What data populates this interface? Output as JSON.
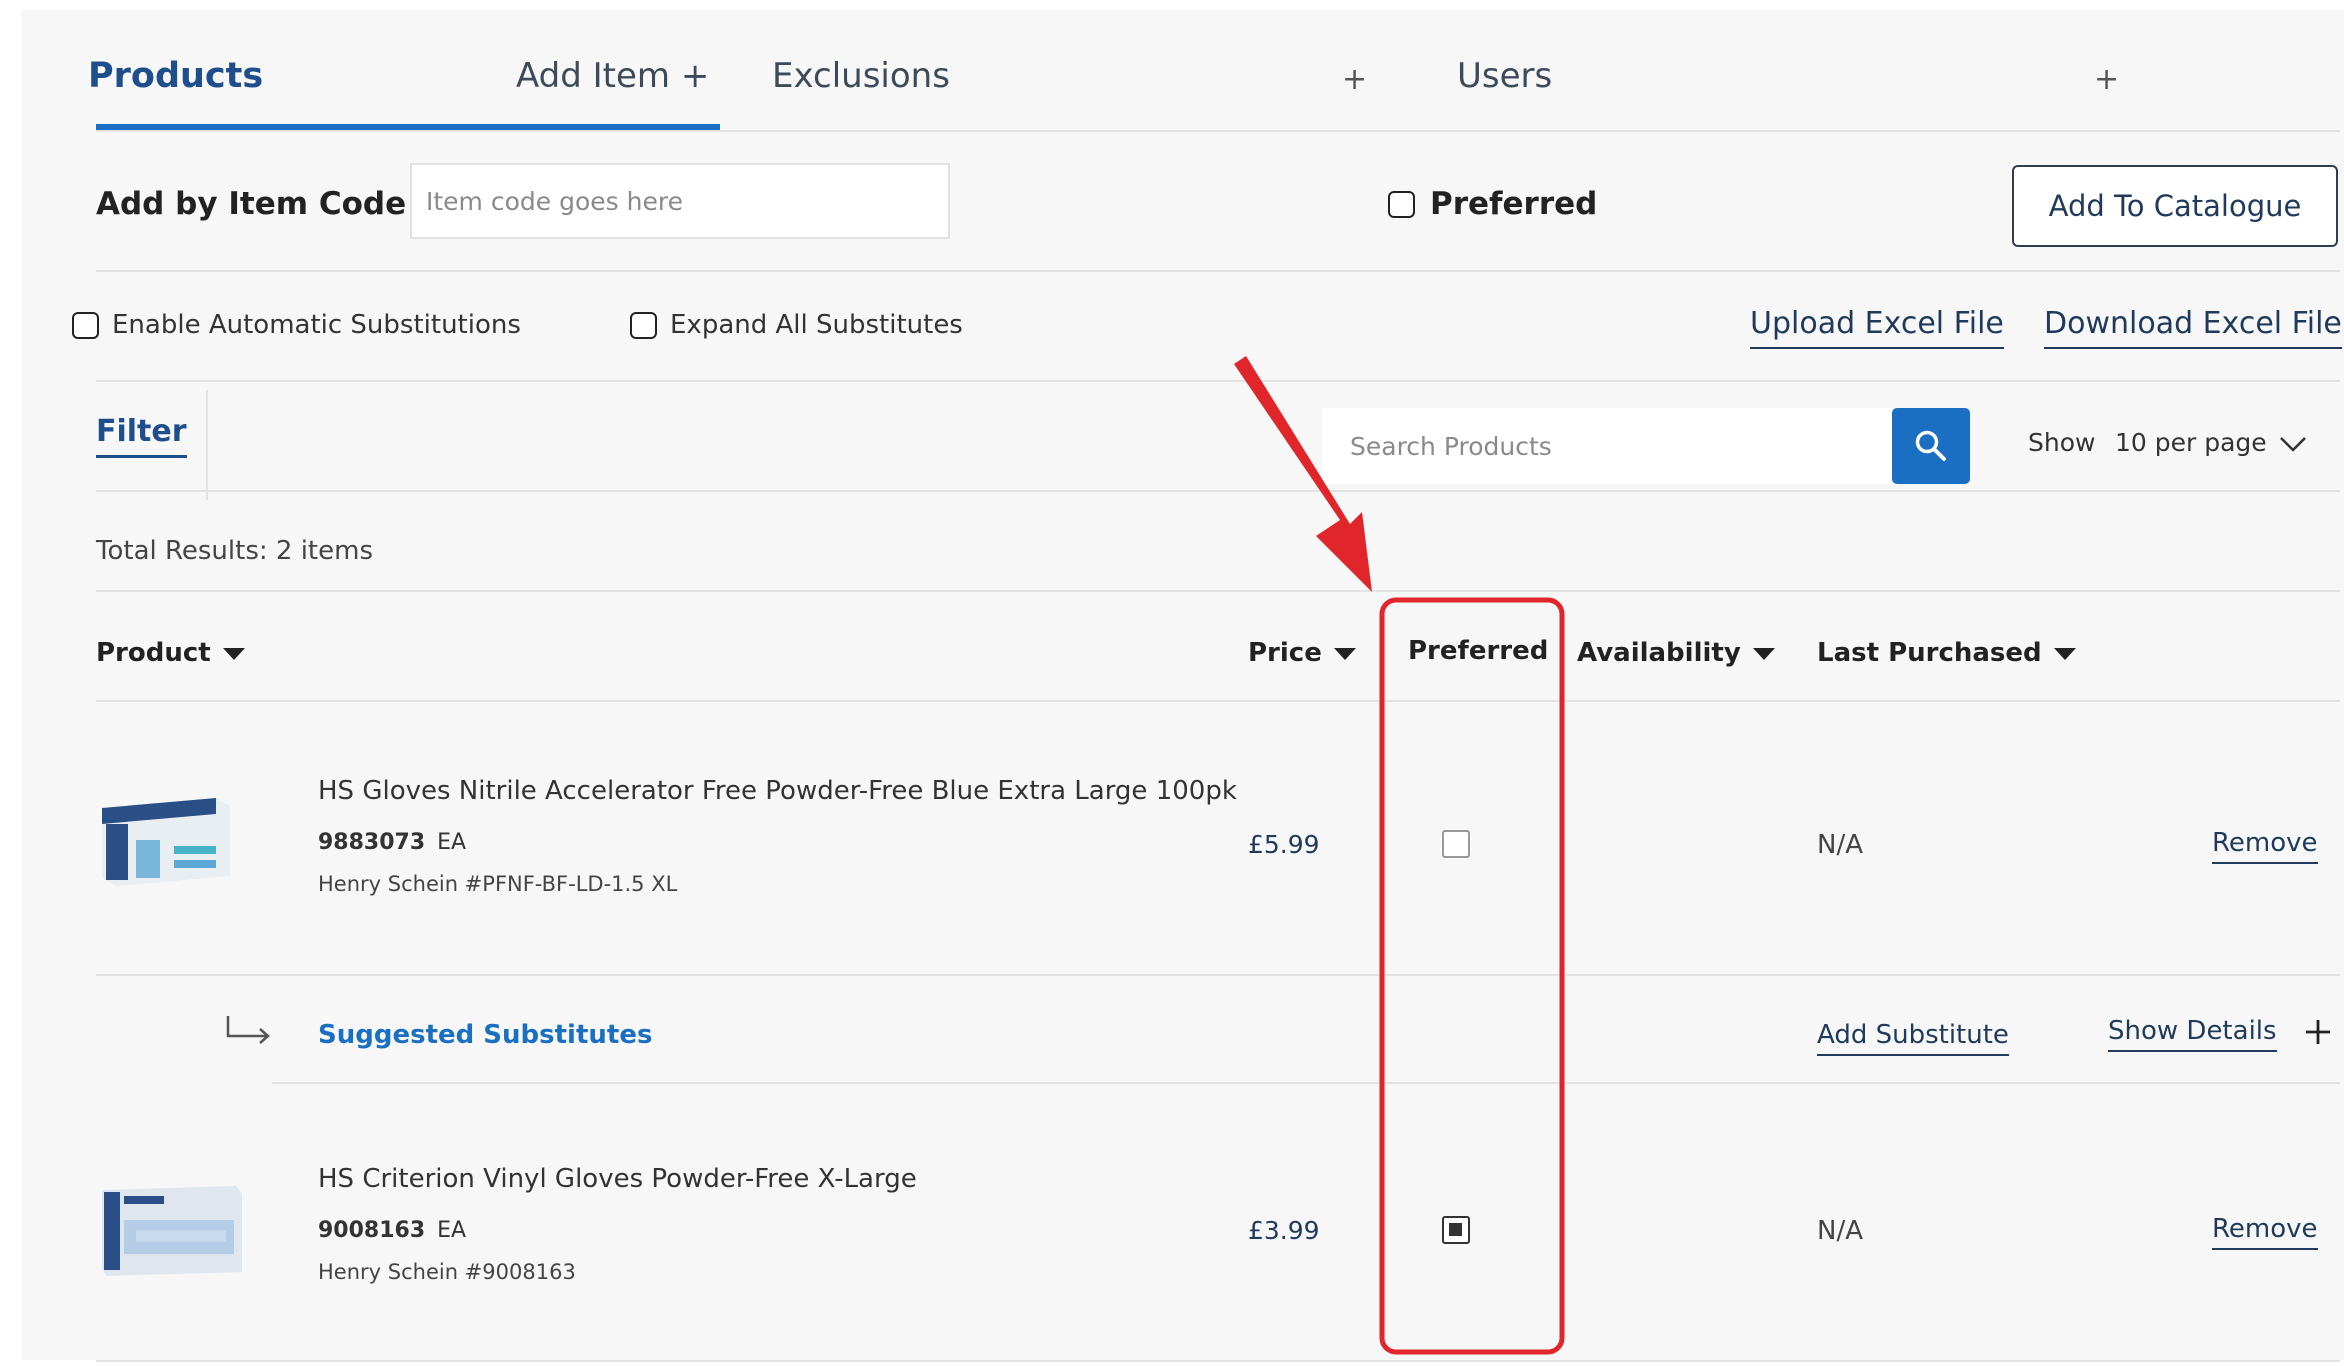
{
  "tabs": [
    {
      "label": "Products"
    },
    {
      "label": "Add Item +"
    },
    {
      "label": "Exclusions"
    },
    {
      "label": "+"
    },
    {
      "label": "Users"
    },
    {
      "label": "+"
    }
  ],
  "add_item": {
    "label": "Add by Item Code",
    "placeholder": "Item code goes here",
    "preferred_label": "Preferred",
    "button": "Add To Catalogue"
  },
  "options": {
    "auto_sub": "Enable Automatic Substitutions",
    "expand_all": "Expand All Substitutes",
    "upload": "Upload Excel File",
    "download": "Download Excel File"
  },
  "filter": {
    "label": "Filter",
    "search_placeholder": "Search Products",
    "show_label": "Show",
    "per_page": "10 per page"
  },
  "total_results": "Total Results: 2 items",
  "columns": {
    "product": "Product",
    "price": "Price",
    "preferred": "Preferred",
    "availability": "Availability",
    "last_purchased": "Last Purchased"
  },
  "rows": [
    {
      "name": "HS Gloves Nitrile Accelerator Free Powder-Free Blue Extra Large 100pk",
      "code": "9883073",
      "unit": "EA",
      "brand": "Henry Schein #PFNF-BF-LD-1.5 XL",
      "price": "£5.99",
      "preferred": false,
      "last_purchased": "N/A",
      "remove": "Remove"
    },
    {
      "name": "HS Criterion Vinyl Gloves Powder-Free X-Large",
      "code": "9008163",
      "unit": "EA",
      "brand": "Henry Schein #9008163",
      "price": "£3.99",
      "preferred": true,
      "last_purchased": "N/A",
      "remove": "Remove"
    }
  ],
  "substitutes": {
    "label": "Suggested Substitutes",
    "add": "Add Substitute",
    "details": "Show Details"
  },
  "colors": {
    "accent": "#1a6fc2",
    "annotation": "#e0262a",
    "link": "#1f3a5a"
  },
  "icons": [
    "search-icon",
    "chevron-down-icon",
    "sort-caret-icon",
    "sub-arrow-icon",
    "plus-icon",
    "annotation-arrow"
  ]
}
